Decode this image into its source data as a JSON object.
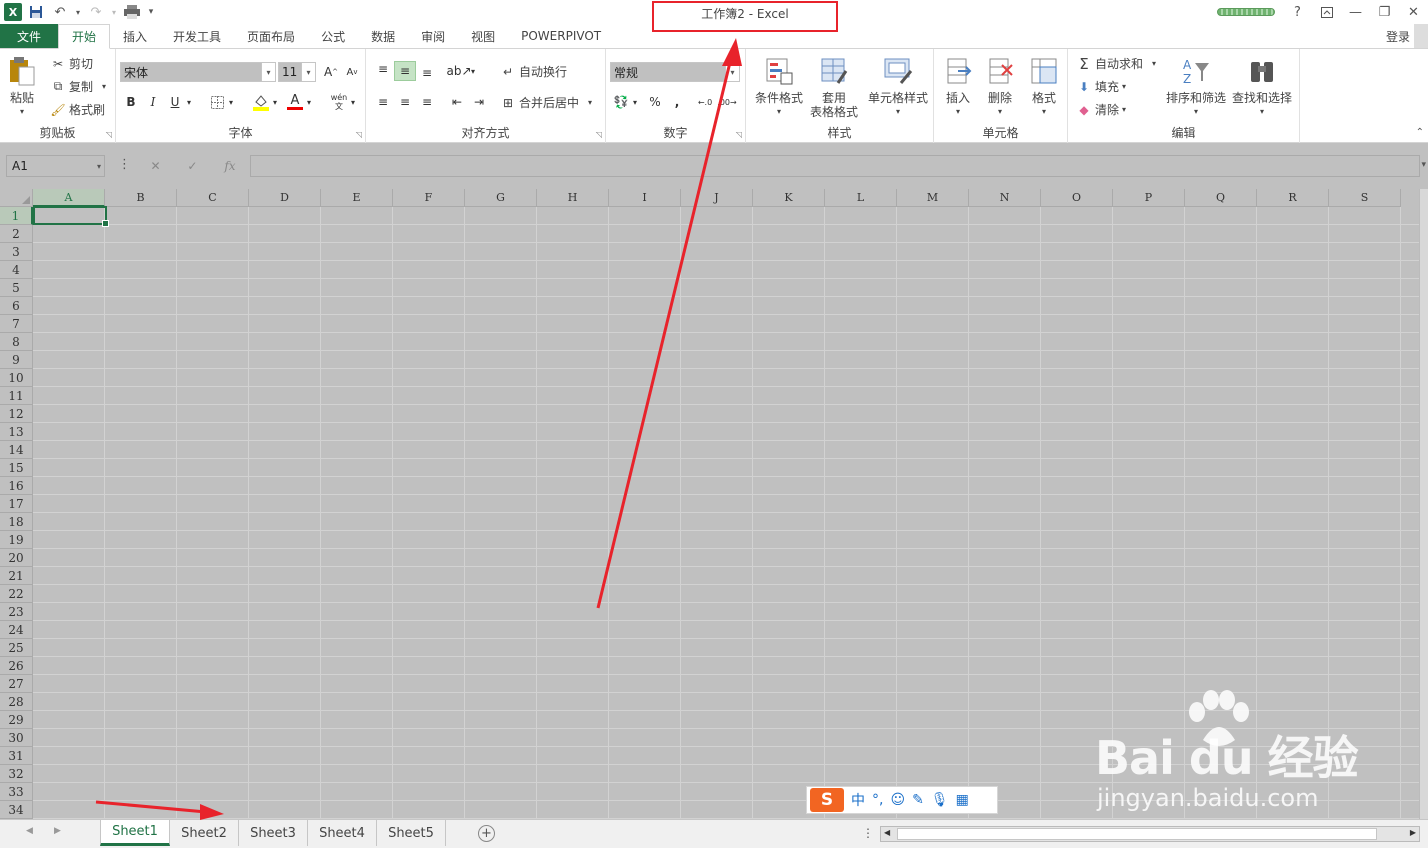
{
  "window": {
    "title": "工作簿2 - Excel",
    "login": "登录"
  },
  "tabs": [
    "文件",
    "开始",
    "插入",
    "开发工具",
    "页面布局",
    "公式",
    "数据",
    "审阅",
    "视图",
    "POWERPIVOT"
  ],
  "active_tab": "开始",
  "ribbon": {
    "clipboard": {
      "label": "剪贴板",
      "paste": "粘贴",
      "cut": "剪切",
      "copy": "复制",
      "format_painter": "格式刷"
    },
    "font": {
      "label": "字体",
      "font_name": "宋体",
      "font_size": "11",
      "bold": "B",
      "italic": "I",
      "underline": "U",
      "phonetic": "wén"
    },
    "alignment": {
      "label": "对齐方式",
      "wrap_text": "自动换行",
      "merge_center": "合并后居中"
    },
    "number": {
      "label": "数字",
      "format": "常规",
      "percent": "%",
      "comma": ","
    },
    "styles": {
      "label": "样式",
      "conditional": "条件格式",
      "table_line1": "套用",
      "table_line2": "表格格式",
      "cell_styles": "单元格样式"
    },
    "cells": {
      "label": "单元格",
      "insert": "插入",
      "delete": "删除",
      "format": "格式"
    },
    "editing": {
      "label": "编辑",
      "autosum": "自动求和",
      "fill": "填充",
      "clear": "清除",
      "sort_filter": "排序和筛选",
      "find_select": "查找和选择"
    }
  },
  "formula_bar": {
    "name_box": "A1",
    "fx": "fx",
    "value": ""
  },
  "columns": [
    "A",
    "B",
    "C",
    "D",
    "E",
    "F",
    "G",
    "H",
    "I",
    "J",
    "K",
    "L",
    "M",
    "N",
    "O",
    "P",
    "Q",
    "R",
    "S"
  ],
  "rows": [
    "1",
    "2",
    "3",
    "4",
    "5",
    "6",
    "7",
    "8",
    "9",
    "10",
    "11",
    "12",
    "13",
    "14",
    "15",
    "16",
    "17",
    "18",
    "19",
    "20",
    "21",
    "22",
    "23",
    "24",
    "25",
    "26",
    "27",
    "28",
    "29",
    "30",
    "31",
    "32",
    "33",
    "34"
  ],
  "active_cell": "A1",
  "sheets": [
    "Sheet1",
    "Sheet2",
    "Sheet3",
    "Sheet4",
    "Sheet5"
  ],
  "active_sheet": "Sheet1",
  "ime": {
    "lang": "中",
    "punct": "°,"
  },
  "watermark": {
    "brand": "Bai du 经验",
    "url": "jingyan.baidu.com"
  },
  "colors": {
    "excel_green": "#217346",
    "annotation_red": "#e8232b",
    "canvas_gray": "#c0c0c0"
  }
}
